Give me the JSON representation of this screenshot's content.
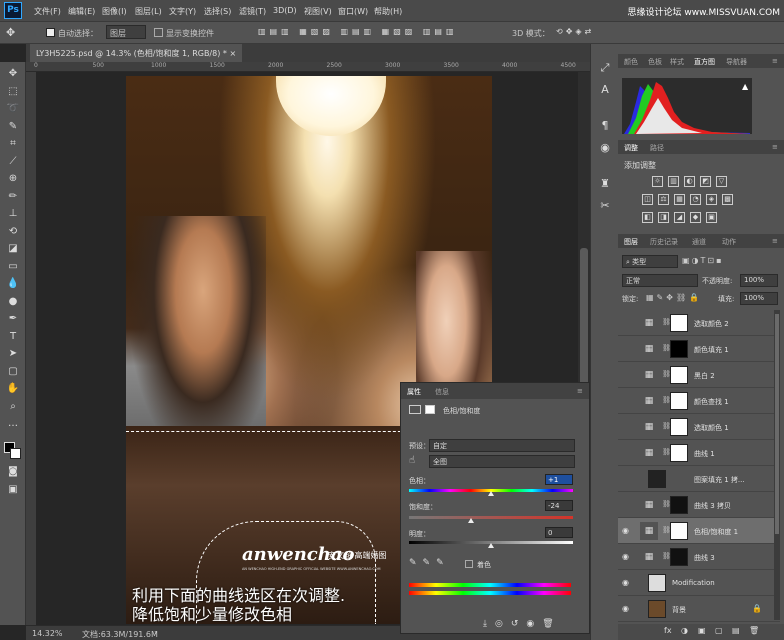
{
  "app": {
    "logo": "Ps"
  },
  "menus": [
    "文件(F)",
    "编辑(E)",
    "图像(I)",
    "图层(L)",
    "文字(Y)",
    "选择(S)",
    "滤镜(T)",
    "3D(D)",
    "视图(V)",
    "窗口(W)",
    "帮助(H)"
  ],
  "watermark": "思缘设计论坛 www.MISSVUAN.COM",
  "options": {
    "auto_select_label": "自动选择：",
    "auto_select_value": "图层",
    "show_transform": "显示变换控件",
    "mode_3d": "3D 模式："
  },
  "document": {
    "tab": "LY3H5225.psd @ 14.3% (色相/饱和度 1, RGB/8) *",
    "zoom": "14.32%",
    "doc_size": "文档:63.3M/191.6M"
  },
  "ruler_ticks": [
    "0",
    "500",
    "1000",
    "1500",
    "2000",
    "2500",
    "3000",
    "3500",
    "4000",
    "4500"
  ],
  "canvas": {
    "brand": "anwenchao",
    "brand_cn": "安文超 高端婚图",
    "brand_sub": "AN WENCHAO HIGH-END GRAPHIC OFFICIAL WEBSITE WWW.ANWENCHAO.COM",
    "caption1": "利用下面的曲线选区在次调整.",
    "caption2": "降低饱和少量修改色相"
  },
  "top_panel": {
    "tabs": [
      "颜色",
      "色板",
      "样式",
      "直方图",
      "导航器"
    ],
    "active": "直方图",
    "warning": "▲"
  },
  "adjust_panel": {
    "tabs": [
      "调整",
      "路径"
    ],
    "active": "调整",
    "title": "添加调整"
  },
  "layers_panel": {
    "tabs": [
      "图层",
      "历史记录",
      "通道",
      "动作"
    ],
    "active": "图层",
    "kind": "类型",
    "blend": "正常",
    "opacity_label": "不透明度:",
    "opacity": "100%",
    "lock_label": "锁定:",
    "fill_label": "填充:",
    "fill": "100%",
    "layers": [
      {
        "name": "选取颜色 2",
        "visible": false,
        "selected": false
      },
      {
        "name": "颜色填充 1",
        "visible": false,
        "selected": false
      },
      {
        "name": "黑白 2",
        "visible": false,
        "selected": false
      },
      {
        "name": "颜色查找 1",
        "visible": false,
        "selected": false
      },
      {
        "name": "选取颜色 1",
        "visible": false,
        "selected": false
      },
      {
        "name": "曲线 1",
        "visible": false,
        "selected": false
      },
      {
        "name": "图案填充 1 拷...",
        "visible": false,
        "selected": false
      },
      {
        "name": "曲线 3 拷贝",
        "visible": false,
        "selected": false
      },
      {
        "name": "色相/饱和度 1",
        "visible": true,
        "selected": true
      },
      {
        "name": "曲线 3",
        "visible": true,
        "selected": false
      },
      {
        "name": "Modification",
        "visible": true,
        "selected": false
      },
      {
        "name": "背景",
        "visible": true,
        "selected": false
      }
    ],
    "footer": [
      "fx",
      "◑",
      "▣",
      "▢",
      "▤",
      "🗑"
    ]
  },
  "properties": {
    "tabs": [
      "属性",
      "信息"
    ],
    "active": "属性",
    "title": "色相/饱和度",
    "preset_label": "预设：",
    "preset": "自定",
    "channel": "全图",
    "hue_label": "色相：",
    "hue": "+1",
    "hue_fraction": 0.502,
    "sat_label": "饱和度：",
    "sat": "-24",
    "sat_fraction": 0.38,
    "light_label": "明度：",
    "light": "0",
    "light_fraction": 0.5,
    "colorize_label": "着色"
  },
  "colors": {
    "accent": "#31a8ff",
    "panel": "#535353",
    "dark": "#262626"
  }
}
